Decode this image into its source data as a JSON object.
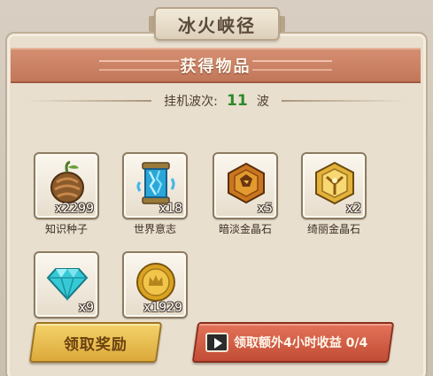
{
  "title": "冰火峡径",
  "banner": "获得物品",
  "wave": {
    "label": "挂机波次:",
    "value": "11",
    "unit": "波"
  },
  "items": [
    {
      "name": "知识种子",
      "qty": "x2299",
      "icon": "seed-icon"
    },
    {
      "name": "世界意志",
      "qty": "x18",
      "icon": "world-will-icon"
    },
    {
      "name": "暗淡金晶石",
      "qty": "x5",
      "icon": "dim-gold-crystal-icon"
    },
    {
      "name": "绮丽金晶石",
      "qty": "x2",
      "icon": "gorgeous-gold-crystal-icon"
    },
    {
      "name": "",
      "qty": "x9",
      "icon": "diamond-icon"
    },
    {
      "name": "",
      "qty": "x1929",
      "icon": "gold-coin-icon"
    }
  ],
  "buttons": {
    "claim": "领取奖励",
    "extra": "领取额外4小时收益 0/4"
  },
  "colors": {
    "banner": "#c9805f",
    "wave_number": "#2c8a2c",
    "claim_button": "#e6b94a",
    "extra_button": "#d35f46"
  }
}
